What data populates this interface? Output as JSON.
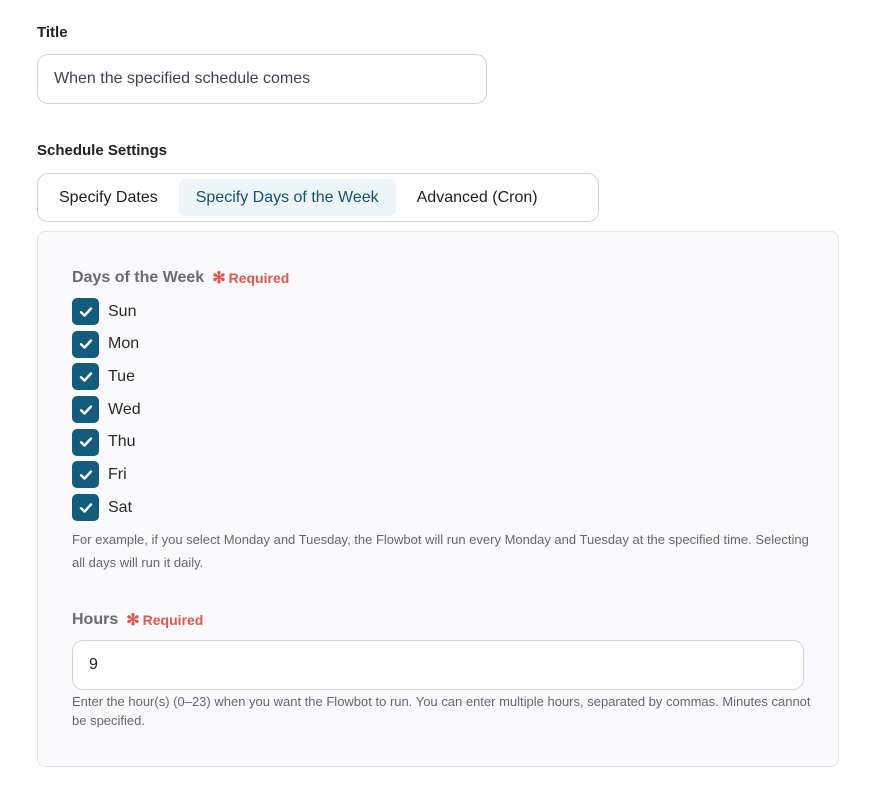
{
  "title_field": {
    "label": "Title",
    "value": "When the specified schedule comes"
  },
  "schedule": {
    "label": "Schedule Settings",
    "tabs": [
      {
        "label": "Specify Dates",
        "active": false
      },
      {
        "label": "Specify Days of the Week",
        "active": true
      },
      {
        "label": "Advanced (Cron)",
        "active": false
      }
    ]
  },
  "days_field": {
    "label": "Days of the Week",
    "required": "Required",
    "days": [
      {
        "label": "Sun",
        "checked": true
      },
      {
        "label": "Mon",
        "checked": true
      },
      {
        "label": "Tue",
        "checked": true
      },
      {
        "label": "Wed",
        "checked": true
      },
      {
        "label": "Thu",
        "checked": true
      },
      {
        "label": "Fri",
        "checked": true
      },
      {
        "label": "Sat",
        "checked": true
      }
    ],
    "help": "For example, if you select Monday and Tuesday, the Flowbot will run every Monday and Tuesday at the specified time. Selecting all days will run it daily."
  },
  "hours_field": {
    "label": "Hours",
    "required": "Required",
    "value": "9",
    "help": "Enter the hour(s) (0–23) when you want the Flowbot to run. You can enter multiple hours, separated by commas. Minutes cannot be specified."
  },
  "colors": {
    "accent": "#125c7e",
    "required": "#e2574c",
    "active_tab_bg": "#eef5f9"
  }
}
